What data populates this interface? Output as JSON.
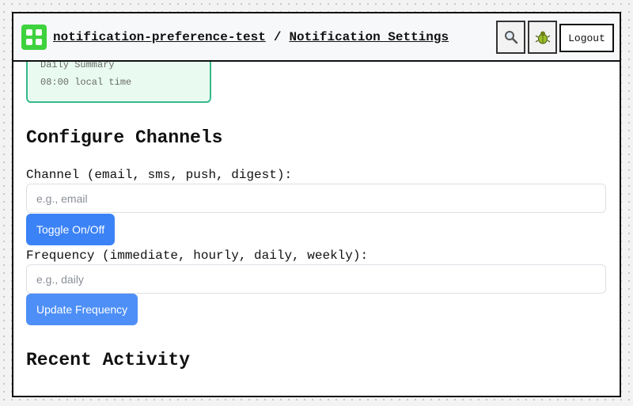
{
  "header": {
    "project": "notification-preference-test",
    "separator": "/",
    "page": "Notification Settings",
    "logout_label": "Logout",
    "icons": {
      "logo": "app-logo-icon",
      "search": "search-icon",
      "debug": "bug-icon"
    }
  },
  "summary_card": {
    "title": "Daily Summary",
    "time": "08:00 local time"
  },
  "configure": {
    "heading": "Configure Channels",
    "channel_label": "Channel (email, sms, push, digest):",
    "channel_placeholder": "e.g., email",
    "toggle_label": "Toggle On/Off",
    "frequency_label": "Frequency (immediate, hourly, daily, weekly):",
    "frequency_placeholder": "e.g., daily",
    "update_label": "Update Frequency"
  },
  "activity": {
    "heading": "Recent Activity"
  },
  "colors": {
    "accent": "#3b82f6",
    "logo_green": "#3ed23e",
    "card_border": "#37b98b",
    "card_bg": "#e9fbf1",
    "activity_bar": "#5b5be8"
  }
}
